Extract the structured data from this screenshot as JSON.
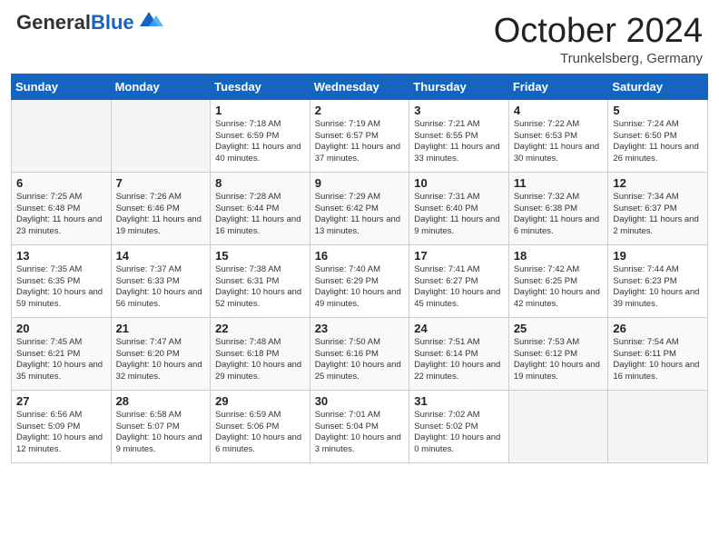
{
  "header": {
    "logo_general": "General",
    "logo_blue": "Blue",
    "month_title": "October 2024",
    "location": "Trunkelsberg, Germany"
  },
  "days_of_week": [
    "Sunday",
    "Monday",
    "Tuesday",
    "Wednesday",
    "Thursday",
    "Friday",
    "Saturday"
  ],
  "weeks": [
    [
      {
        "day": "",
        "sunrise": "",
        "sunset": "",
        "daylight": "",
        "empty": true
      },
      {
        "day": "",
        "sunrise": "",
        "sunset": "",
        "daylight": "",
        "empty": true
      },
      {
        "day": "1",
        "sunrise": "Sunrise: 7:18 AM",
        "sunset": "Sunset: 6:59 PM",
        "daylight": "Daylight: 11 hours and 40 minutes.",
        "empty": false
      },
      {
        "day": "2",
        "sunrise": "Sunrise: 7:19 AM",
        "sunset": "Sunset: 6:57 PM",
        "daylight": "Daylight: 11 hours and 37 minutes.",
        "empty": false
      },
      {
        "day": "3",
        "sunrise": "Sunrise: 7:21 AM",
        "sunset": "Sunset: 6:55 PM",
        "daylight": "Daylight: 11 hours and 33 minutes.",
        "empty": false
      },
      {
        "day": "4",
        "sunrise": "Sunrise: 7:22 AM",
        "sunset": "Sunset: 6:53 PM",
        "daylight": "Daylight: 11 hours and 30 minutes.",
        "empty": false
      },
      {
        "day": "5",
        "sunrise": "Sunrise: 7:24 AM",
        "sunset": "Sunset: 6:50 PM",
        "daylight": "Daylight: 11 hours and 26 minutes.",
        "empty": false
      }
    ],
    [
      {
        "day": "6",
        "sunrise": "Sunrise: 7:25 AM",
        "sunset": "Sunset: 6:48 PM",
        "daylight": "Daylight: 11 hours and 23 minutes.",
        "empty": false
      },
      {
        "day": "7",
        "sunrise": "Sunrise: 7:26 AM",
        "sunset": "Sunset: 6:46 PM",
        "daylight": "Daylight: 11 hours and 19 minutes.",
        "empty": false
      },
      {
        "day": "8",
        "sunrise": "Sunrise: 7:28 AM",
        "sunset": "Sunset: 6:44 PM",
        "daylight": "Daylight: 11 hours and 16 minutes.",
        "empty": false
      },
      {
        "day": "9",
        "sunrise": "Sunrise: 7:29 AM",
        "sunset": "Sunset: 6:42 PM",
        "daylight": "Daylight: 11 hours and 13 minutes.",
        "empty": false
      },
      {
        "day": "10",
        "sunrise": "Sunrise: 7:31 AM",
        "sunset": "Sunset: 6:40 PM",
        "daylight": "Daylight: 11 hours and 9 minutes.",
        "empty": false
      },
      {
        "day": "11",
        "sunrise": "Sunrise: 7:32 AM",
        "sunset": "Sunset: 6:38 PM",
        "daylight": "Daylight: 11 hours and 6 minutes.",
        "empty": false
      },
      {
        "day": "12",
        "sunrise": "Sunrise: 7:34 AM",
        "sunset": "Sunset: 6:37 PM",
        "daylight": "Daylight: 11 hours and 2 minutes.",
        "empty": false
      }
    ],
    [
      {
        "day": "13",
        "sunrise": "Sunrise: 7:35 AM",
        "sunset": "Sunset: 6:35 PM",
        "daylight": "Daylight: 10 hours and 59 minutes.",
        "empty": false
      },
      {
        "day": "14",
        "sunrise": "Sunrise: 7:37 AM",
        "sunset": "Sunset: 6:33 PM",
        "daylight": "Daylight: 10 hours and 56 minutes.",
        "empty": false
      },
      {
        "day": "15",
        "sunrise": "Sunrise: 7:38 AM",
        "sunset": "Sunset: 6:31 PM",
        "daylight": "Daylight: 10 hours and 52 minutes.",
        "empty": false
      },
      {
        "day": "16",
        "sunrise": "Sunrise: 7:40 AM",
        "sunset": "Sunset: 6:29 PM",
        "daylight": "Daylight: 10 hours and 49 minutes.",
        "empty": false
      },
      {
        "day": "17",
        "sunrise": "Sunrise: 7:41 AM",
        "sunset": "Sunset: 6:27 PM",
        "daylight": "Daylight: 10 hours and 45 minutes.",
        "empty": false
      },
      {
        "day": "18",
        "sunrise": "Sunrise: 7:42 AM",
        "sunset": "Sunset: 6:25 PM",
        "daylight": "Daylight: 10 hours and 42 minutes.",
        "empty": false
      },
      {
        "day": "19",
        "sunrise": "Sunrise: 7:44 AM",
        "sunset": "Sunset: 6:23 PM",
        "daylight": "Daylight: 10 hours and 39 minutes.",
        "empty": false
      }
    ],
    [
      {
        "day": "20",
        "sunrise": "Sunrise: 7:45 AM",
        "sunset": "Sunset: 6:21 PM",
        "daylight": "Daylight: 10 hours and 35 minutes.",
        "empty": false
      },
      {
        "day": "21",
        "sunrise": "Sunrise: 7:47 AM",
        "sunset": "Sunset: 6:20 PM",
        "daylight": "Daylight: 10 hours and 32 minutes.",
        "empty": false
      },
      {
        "day": "22",
        "sunrise": "Sunrise: 7:48 AM",
        "sunset": "Sunset: 6:18 PM",
        "daylight": "Daylight: 10 hours and 29 minutes.",
        "empty": false
      },
      {
        "day": "23",
        "sunrise": "Sunrise: 7:50 AM",
        "sunset": "Sunset: 6:16 PM",
        "daylight": "Daylight: 10 hours and 25 minutes.",
        "empty": false
      },
      {
        "day": "24",
        "sunrise": "Sunrise: 7:51 AM",
        "sunset": "Sunset: 6:14 PM",
        "daylight": "Daylight: 10 hours and 22 minutes.",
        "empty": false
      },
      {
        "day": "25",
        "sunrise": "Sunrise: 7:53 AM",
        "sunset": "Sunset: 6:12 PM",
        "daylight": "Daylight: 10 hours and 19 minutes.",
        "empty": false
      },
      {
        "day": "26",
        "sunrise": "Sunrise: 7:54 AM",
        "sunset": "Sunset: 6:11 PM",
        "daylight": "Daylight: 10 hours and 16 minutes.",
        "empty": false
      }
    ],
    [
      {
        "day": "27",
        "sunrise": "Sunrise: 6:56 AM",
        "sunset": "Sunset: 5:09 PM",
        "daylight": "Daylight: 10 hours and 12 minutes.",
        "empty": false
      },
      {
        "day": "28",
        "sunrise": "Sunrise: 6:58 AM",
        "sunset": "Sunset: 5:07 PM",
        "daylight": "Daylight: 10 hours and 9 minutes.",
        "empty": false
      },
      {
        "day": "29",
        "sunrise": "Sunrise: 6:59 AM",
        "sunset": "Sunset: 5:06 PM",
        "daylight": "Daylight: 10 hours and 6 minutes.",
        "empty": false
      },
      {
        "day": "30",
        "sunrise": "Sunrise: 7:01 AM",
        "sunset": "Sunset: 5:04 PM",
        "daylight": "Daylight: 10 hours and 3 minutes.",
        "empty": false
      },
      {
        "day": "31",
        "sunrise": "Sunrise: 7:02 AM",
        "sunset": "Sunset: 5:02 PM",
        "daylight": "Daylight: 10 hours and 0 minutes.",
        "empty": false
      },
      {
        "day": "",
        "sunrise": "",
        "sunset": "",
        "daylight": "",
        "empty": true
      },
      {
        "day": "",
        "sunrise": "",
        "sunset": "",
        "daylight": "",
        "empty": true
      }
    ]
  ]
}
